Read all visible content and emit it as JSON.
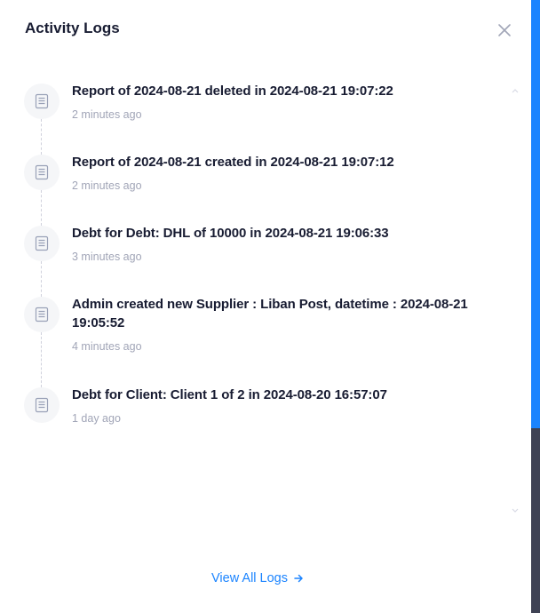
{
  "header": {
    "title": "Activity Logs",
    "close_icon": "close-icon"
  },
  "logs": [
    {
      "text": "Report of 2024-08-21 deleted in 2024-08-21 19:07:22",
      "time": "2 minutes ago",
      "icon": "document-icon"
    },
    {
      "text": "Report of 2024-08-21 created in 2024-08-21 19:07:12",
      "time": "2 minutes ago",
      "icon": "document-icon"
    },
    {
      "text": "Debt for Debt: DHL of 10000 in 2024-08-21 19:06:33",
      "time": "3 minutes ago",
      "icon": "document-icon"
    },
    {
      "text": "Admin created new Supplier : Liban Post, datetime : 2024-08-21 19:05:52",
      "time": "4 minutes ago",
      "icon": "document-icon"
    },
    {
      "text": "Debt for Client: Client 1 of 2 in 2024-08-20 16:57:07",
      "time": "1 day ago",
      "icon": "document-icon"
    }
  ],
  "footer": {
    "view_all_label": "View All Logs",
    "arrow_icon": "arrow-right-icon"
  },
  "colors": {
    "accent": "#1b84ff",
    "text": "#181c32",
    "muted": "#a1a5b7"
  }
}
